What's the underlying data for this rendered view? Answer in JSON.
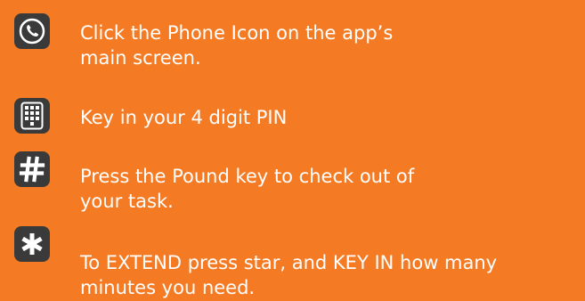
{
  "steps": [
    {
      "icon": "phone-icon",
      "lines": [
        "Click the Phone Icon on the app’s",
        "main screen."
      ]
    },
    {
      "icon": "keypad-icon",
      "lines": [
        "Key in your 4 digit PIN"
      ]
    },
    {
      "icon": "pound-icon",
      "lines": [
        "Press the Pound key to check out of",
        "your task."
      ]
    },
    {
      "icon": "star-icon",
      "lines": [
        "To EXTEND press star, and KEY IN how many",
        "minutes you need."
      ]
    }
  ],
  "colors": {
    "background": "#F47B23",
    "icon_background": "#3a3a3a",
    "text": "#ffffff"
  }
}
